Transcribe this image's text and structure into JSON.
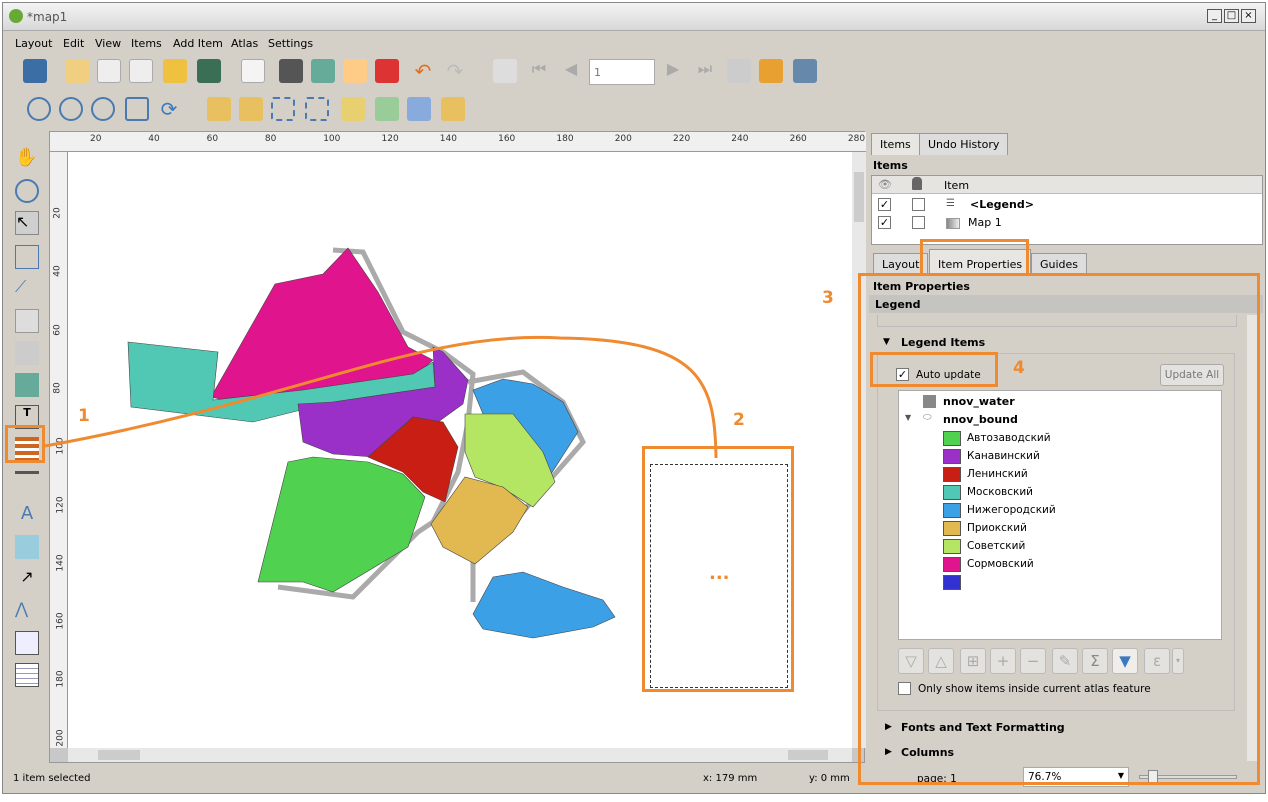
{
  "window": {
    "title": "*map1",
    "min": "_",
    "max": "□",
    "close": "×"
  },
  "menu": [
    "Layout",
    "Edit",
    "View",
    "Items",
    "Add Item",
    "Atlas",
    "Settings"
  ],
  "toolbar": {
    "page_value": "1"
  },
  "ruler": {
    "top": [
      "20",
      "40",
      "60",
      "80",
      "100",
      "120",
      "140",
      "160",
      "180",
      "200",
      "220",
      "240",
      "260",
      "280"
    ],
    "left": [
      "20",
      "40",
      "60",
      "80",
      "100",
      "120",
      "140",
      "160",
      "180",
      "200"
    ]
  },
  "status": {
    "selected": "1 item selected",
    "x": "x: 179 mm",
    "y": "y: 0 mm",
    "page": "page: 1",
    "zoom": "76.7%"
  },
  "panel": {
    "tabs": [
      "Items",
      "Undo History"
    ],
    "items_title": "Items",
    "items_col": "Item",
    "items": [
      {
        "name": "<Legend>",
        "visible": true,
        "locked": false
      },
      {
        "name": "Map 1",
        "visible": true,
        "locked": false
      }
    ],
    "lower_tabs": [
      "Layout",
      "Item Properties",
      "Guides"
    ],
    "props_title": "Item Properties",
    "props_sub": "Legend",
    "legend_items_header": "Legend Items",
    "auto_update": "Auto update",
    "update_all": "Update All",
    "tree": {
      "layer1": "nnov_water",
      "layer2": "nnov_bound",
      "classes": [
        {
          "label": "Автозаводский",
          "color": "#50d250"
        },
        {
          "label": "Канавинский",
          "color": "#9b30c8"
        },
        {
          "label": "Ленинский",
          "color": "#c81e14"
        },
        {
          "label": "Московский",
          "color": "#50c8b4"
        },
        {
          "label": "Нижегородский",
          "color": "#3ca0e6"
        },
        {
          "label": "Приокский",
          "color": "#e1b950"
        },
        {
          "label": "Советский",
          "color": "#b4e664"
        },
        {
          "label": "Сормовский",
          "color": "#e0148c"
        },
        {
          "label": "",
          "color": "#3232d2"
        }
      ]
    },
    "atlas_only": "Only show items inside current atlas feature",
    "fonts_section": "Fonts and Text Formatting",
    "columns_section": "Columns"
  },
  "annotations": {
    "n1": "1",
    "n2": "2",
    "n3": "3",
    "n4": "4",
    "ellipsis": "..."
  },
  "accent": "#f08a30"
}
